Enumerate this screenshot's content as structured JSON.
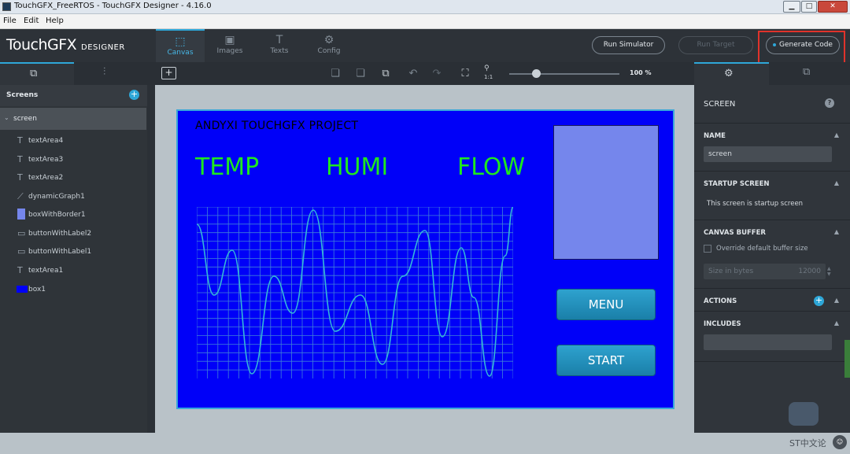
{
  "window": {
    "title": "TouchGFX_FreeRTOS - TouchGFX Designer - 4.16.0"
  },
  "menu": [
    "File",
    "Edit",
    "Help"
  ],
  "logo": {
    "main": "TouchGFX",
    "sub": "DESIGNER"
  },
  "nav_tabs": [
    {
      "label": "Canvas",
      "icon": "canvas-icon",
      "active": true
    },
    {
      "label": "Images",
      "icon": "images-icon",
      "active": false
    },
    {
      "label": "Texts",
      "icon": "texts-icon",
      "active": false
    },
    {
      "label": "Config",
      "icon": "config-icon",
      "active": false
    }
  ],
  "header_buttons": {
    "run_simulator": "Run Simulator",
    "run_target": "Run Target",
    "generate_code": "Generate Code"
  },
  "toolbar": {
    "zoom": "100 %",
    "zoom_reset": "1:1"
  },
  "left_panel": {
    "section_title": "Screens",
    "screen_name": "screen",
    "widgets": [
      {
        "name": "textArea4",
        "icon": "text-icon"
      },
      {
        "name": "textArea3",
        "icon": "text-icon"
      },
      {
        "name": "textArea2",
        "icon": "text-icon"
      },
      {
        "name": "dynamicGraph1",
        "icon": "graph-icon"
      },
      {
        "name": "boxWithBorder1",
        "icon": "box-border-icon"
      },
      {
        "name": "buttonWithLabel2",
        "icon": "button-icon"
      },
      {
        "name": "buttonWithLabel1",
        "icon": "button-icon"
      },
      {
        "name": "textArea1",
        "icon": "text-icon"
      },
      {
        "name": "box1",
        "icon": "box-icon"
      }
    ]
  },
  "lcd": {
    "project_title": "ANDYXI TOUCHGFX PROJECT",
    "labels": [
      "TEMP",
      "HUMI",
      "FLOW"
    ],
    "menu_button": "MENU",
    "start_button": "START",
    "background": "#0000f8",
    "label_color": "#1ee81e",
    "box_color": "#7586ec"
  },
  "right_panel": {
    "title": "SCREEN",
    "name_label": "NAME",
    "name_value": "screen",
    "startup_label": "STARTUP SCREEN",
    "startup_text": "This screen is startup screen",
    "canvas_buffer_label": "CANVAS BUFFER",
    "override_label": "Override default buffer size",
    "size_label": "Size in bytes",
    "size_value": "12000",
    "actions_label": "ACTIONS",
    "includes_label": "INCLUDES"
  },
  "watermark": "ST中文论"
}
